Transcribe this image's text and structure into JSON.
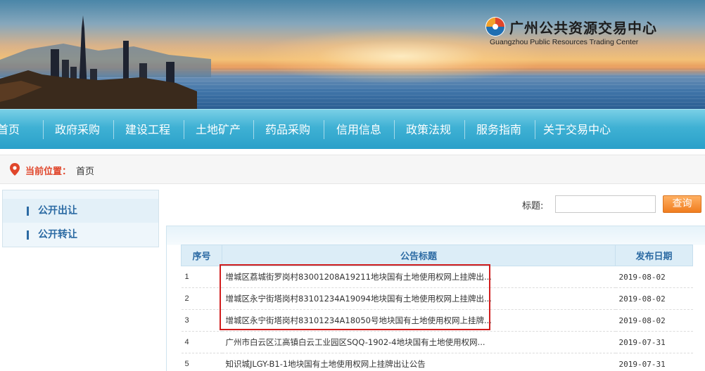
{
  "header": {
    "org_name_cn": "广州公共资源交易中心",
    "org_name_en": "Guangzhou Public Resources Trading Center"
  },
  "nav": {
    "items": [
      {
        "label": "首页"
      },
      {
        "label": "政府采购"
      },
      {
        "label": "建设工程"
      },
      {
        "label": "土地矿产"
      },
      {
        "label": "药品采购"
      },
      {
        "label": "信用信息"
      },
      {
        "label": "政策法规"
      },
      {
        "label": "服务指南"
      },
      {
        "label": "关于交易中心"
      }
    ]
  },
  "breadcrumb": {
    "label": "当前位置：",
    "current": "首页"
  },
  "sidebar": {
    "items": [
      {
        "label": "公开出让"
      },
      {
        "label": "公开转让"
      }
    ]
  },
  "search": {
    "label": "标题:",
    "value": "",
    "button_label": "查询"
  },
  "table": {
    "headers": {
      "no": "序号",
      "title": "公告标题",
      "date": "发布日期"
    },
    "rows": [
      {
        "no": "1",
        "title": "增城区荔城街罗岗村83001208A19211地块国有土地使用权网上挂牌出...",
        "date": "2019-08-02"
      },
      {
        "no": "2",
        "title": "增城区永宁街塔岗村83101234A19094地块国有土地使用权网上挂牌出...",
        "date": "2019-08-02"
      },
      {
        "no": "3",
        "title": "增城区永宁街塔岗村83101234A18050号地块国有土地使用权网上挂牌...",
        "date": "2019-08-02"
      },
      {
        "no": "4",
        "title": "广州市白云区江高镇白云工业园区SQQ-1902-4地块国有土地使用权网...",
        "date": "2019-07-31"
      },
      {
        "no": "5",
        "title": "知识城JLGY-B1-1地块国有土地使用权网上挂牌出让公告",
        "date": "2019-07-31"
      }
    ]
  },
  "colors": {
    "nav_bg": "#2aa0c9",
    "accent_orange": "#f07d1f",
    "highlight_red": "#d11d1d",
    "link_blue": "#2b6aa3"
  }
}
